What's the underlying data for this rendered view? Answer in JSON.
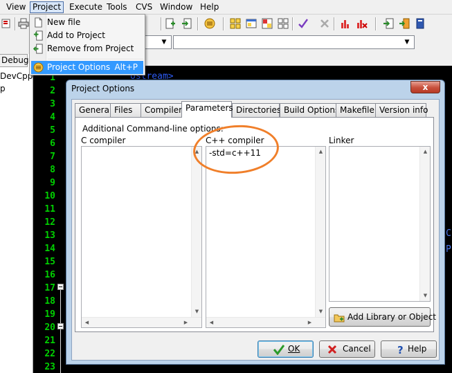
{
  "menubar": {
    "items": [
      "View",
      "Project",
      "Execute",
      "Tools",
      "CVS",
      "Window",
      "Help"
    ],
    "open_item": "Project"
  },
  "left_pane": {
    "tab_label": "Debug",
    "tree_item_1": "DevCpp",
    "tree_item_2": "p"
  },
  "project_menu": {
    "items": [
      {
        "label": "New file",
        "icon": "new-file-icon"
      },
      {
        "label": "Add to Project",
        "icon": "add-to-project-icon"
      },
      {
        "label": "Remove from Project",
        "icon": "remove-from-project-icon"
      },
      {
        "label": "Project Options",
        "shortcut": "Alt+P",
        "icon": "project-options-icon",
        "highlighted": true
      }
    ]
  },
  "editor": {
    "line_numbers": [
      "1",
      "2",
      "3",
      "4",
      "5",
      "6",
      "7",
      "8",
      "9",
      "10",
      "11",
      "12",
      "13",
      "14",
      "15",
      "16",
      "17",
      "18",
      "19",
      "20",
      "21",
      "22",
      "23"
    ],
    "visible_code_fragment": "ostream>",
    "right_edge_fragment_1": "C",
    "right_edge_fragment_2": "P"
  },
  "dialog": {
    "title": "Project Options",
    "close_label": "x",
    "tabs": [
      "General",
      "Files",
      "Compiler",
      "Parameters",
      "Directories",
      "Build Options",
      "Makefile",
      "Version info"
    ],
    "active_tab": "Parameters",
    "section_label": "Additional Command-line options:",
    "c_compiler_label": "C compiler",
    "cpp_compiler_label": "C++ compiler",
    "cpp_compiler_value": "-std=c++11",
    "linker_label": "Linker",
    "add_library_label": "Add Library or Object",
    "ok_label": "OK",
    "cancel_label": "Cancel",
    "help_label": "Help"
  },
  "colors": {
    "annotation": "#f07f2a",
    "menu_highlight": "#3399ff",
    "line_numbers": "#00d000",
    "editor_bg": "#000000"
  }
}
